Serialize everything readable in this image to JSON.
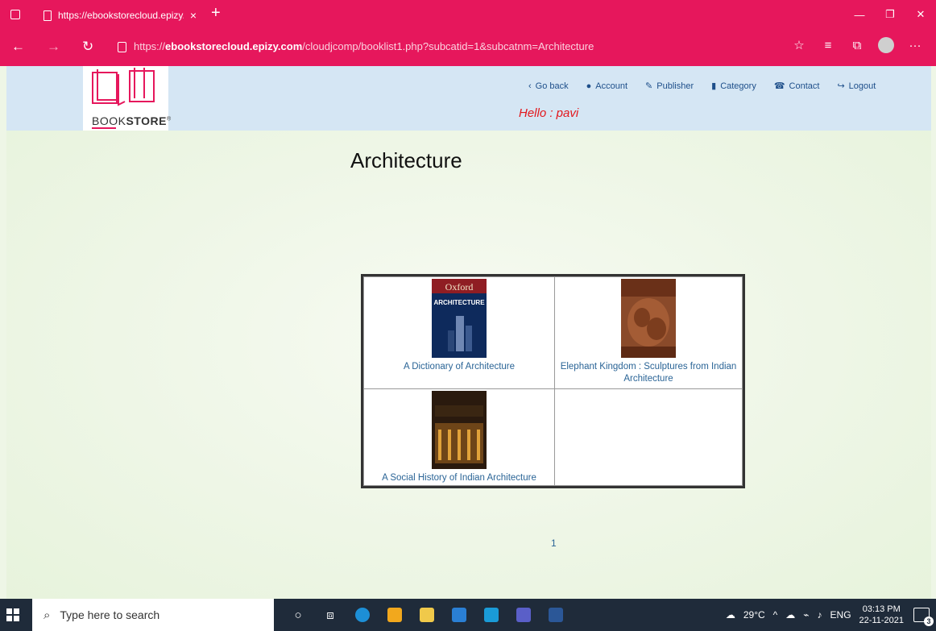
{
  "browser": {
    "tab_title": "https://ebookstorecloud.epizy.co",
    "tab_close": "×",
    "new_tab": "+",
    "window_controls": [
      "—",
      "❐",
      "✕"
    ],
    "url_scheme": "https://",
    "url_host": "ebookstorecloud.epizy.com",
    "url_path": "/cloudjcomp/booklist1.php?subcatid=1&subcatnm=Architecture"
  },
  "logo": {
    "text_light": "BOOK",
    "text_bold": "STORE",
    "registered": "®"
  },
  "nav": {
    "items": [
      {
        "label": "Go back",
        "icon": "chevron-left-icon"
      },
      {
        "label": "Account",
        "icon": "user-icon"
      },
      {
        "label": "Publisher",
        "icon": "edit-icon"
      },
      {
        "label": "Category",
        "icon": "book-icon"
      },
      {
        "label": "Contact",
        "icon": "phone-icon"
      },
      {
        "label": "Logout",
        "icon": "logout-icon"
      }
    ],
    "greeting": "Hello : pavi"
  },
  "page": {
    "title": "Architecture",
    "books": [
      {
        "title": "A Dictionary of Architecture",
        "cover_text": "Oxford",
        "cover_sub": "ARCHITECTURE"
      },
      {
        "title": "Elephant Kingdom : Sculptures from Indian Architecture"
      },
      {
        "title": "A Social History of Indian Architecture"
      }
    ],
    "pagination": "1"
  },
  "taskbar": {
    "search_placeholder": "Type here to search",
    "temperature": "29°C",
    "language": "ENG",
    "time": "03:13 PM",
    "date": "22-11-2021",
    "notification_count": "3"
  },
  "colors": {
    "browser_accent": "#e6175c",
    "header_bg": "#d5e6f4",
    "link": "#2a6496",
    "greeting": "#e3161b"
  }
}
